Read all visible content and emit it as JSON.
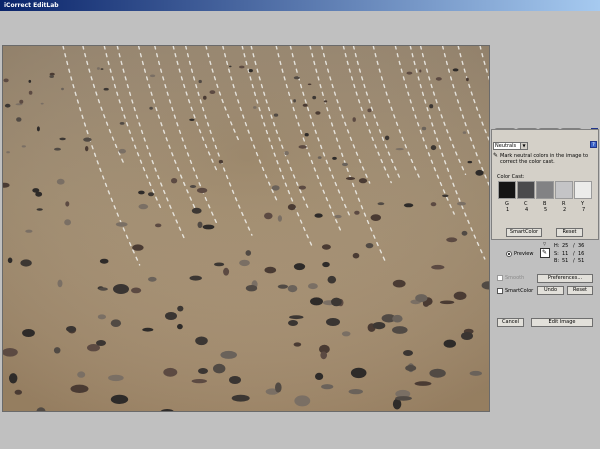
{
  "window": {
    "title": "iCorrect EditLab"
  },
  "panel": {
    "tabs": [
      "neutrals-eyedropper-icon",
      "skin-eyedropper-icon",
      "lightbulb-icon",
      "color-wheel-icon"
    ],
    "mode_select": "Neutrals",
    "instruction": "Mark neutral colors in the image to correct the color cast.",
    "color_cast_label": "Color Cast:",
    "swatches": [
      {
        "label": "G",
        "value": "1",
        "color": "#141414"
      },
      {
        "label": "C",
        "value": "4",
        "color": "#4a4a4c"
      },
      {
        "label": "B",
        "value": "5",
        "color": "#828284"
      },
      {
        "label": "R",
        "value": "2",
        "color": "#c4c4c6"
      },
      {
        "label": "Y",
        "value": "7",
        "color": "#ececea"
      }
    ],
    "smartcolor_button": "SmartColor",
    "reset_button": "Reset"
  },
  "readout": {
    "preview_label": "Preview",
    "h_label": "H:",
    "h1": "25",
    "h2": "36",
    "s_label": "S:",
    "s1": "11",
    "s2": "16",
    "b_label": "B:",
    "b1": "51",
    "b2": "51"
  },
  "controls": {
    "smooth_label": "Smooth",
    "preferences_button": "Preferences...",
    "smartcolor_label": "SmartColor",
    "undo_button": "Undo",
    "reset_button": "Reset",
    "cancel_button": "Cancel",
    "edit_image_button": "Edit Image"
  }
}
